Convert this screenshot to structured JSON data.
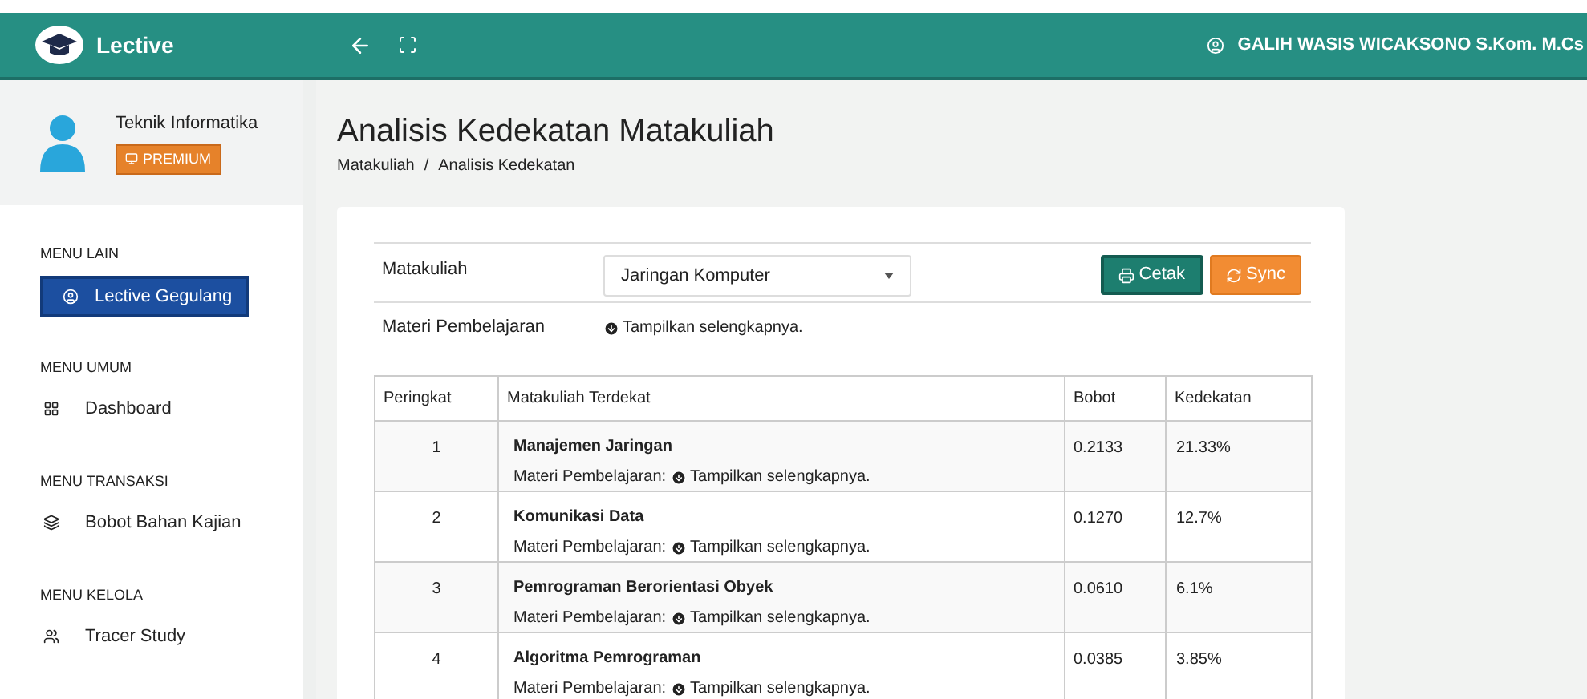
{
  "header": {
    "brand": "Lective",
    "user": "GALIH WASIS WICAKSONO S.Kom. M.Cs"
  },
  "profile": {
    "name": "Teknik Informatika",
    "badge": "PREMIUM"
  },
  "sidebar": {
    "sections": [
      {
        "heading": "MENU LAIN",
        "items": [
          {
            "kind": "button",
            "label": "Lective Gegulang"
          }
        ]
      },
      {
        "heading": "MENU UMUM",
        "items": [
          {
            "kind": "link",
            "label": "Dashboard"
          }
        ]
      },
      {
        "heading": "MENU TRANSAKSI",
        "items": [
          {
            "kind": "link",
            "label": "Bobot Bahan Kajian"
          }
        ]
      },
      {
        "heading": "MENU KELOLA",
        "items": [
          {
            "kind": "link",
            "label": "Tracer Study"
          }
        ]
      }
    ]
  },
  "page": {
    "title": "Analisis Kedekatan Matakuliah",
    "breadcrumb": [
      "Matakuliah",
      "Analisis Kedekatan"
    ],
    "breadcrumb_separator": "/"
  },
  "form": {
    "course_label": "Matakuliah",
    "course_value": "Jaringan Komputer",
    "print_button": "Cetak",
    "sync_button": "Sync",
    "materials_label": "Materi Pembelajaran",
    "materials_link": "Tampilkan selengkapnya."
  },
  "table": {
    "columns": [
      "Peringkat",
      "Matakuliah Terdekat",
      "Bobot",
      "Kedekatan"
    ],
    "rows": [
      {
        "rank": "1",
        "course": "Manajemen Jaringan",
        "materials_label": "Materi Pembelajaran:",
        "materials_link": "Tampilkan selengkapnya.",
        "weight": "0.2133",
        "closeness": "21.33%"
      },
      {
        "rank": "2",
        "course": "Komunikasi Data",
        "materials_label": "Materi Pembelajaran:",
        "materials_link": "Tampilkan selengkapnya.",
        "weight": "0.1270",
        "closeness": "12.7%"
      },
      {
        "rank": "3",
        "course": "Pemrograman Berorientasi Obyek",
        "materials_label": "Materi Pembelajaran:",
        "materials_link": "Tampilkan selengkapnya.",
        "weight": "0.0610",
        "closeness": "6.1%"
      },
      {
        "rank": "4",
        "course": "Algoritma Pemrograman",
        "materials_label": "Materi Pembelajaran:",
        "materials_link": "Tampilkan selengkapnya.",
        "weight": "0.0385",
        "closeness": "3.85%"
      }
    ]
  }
}
